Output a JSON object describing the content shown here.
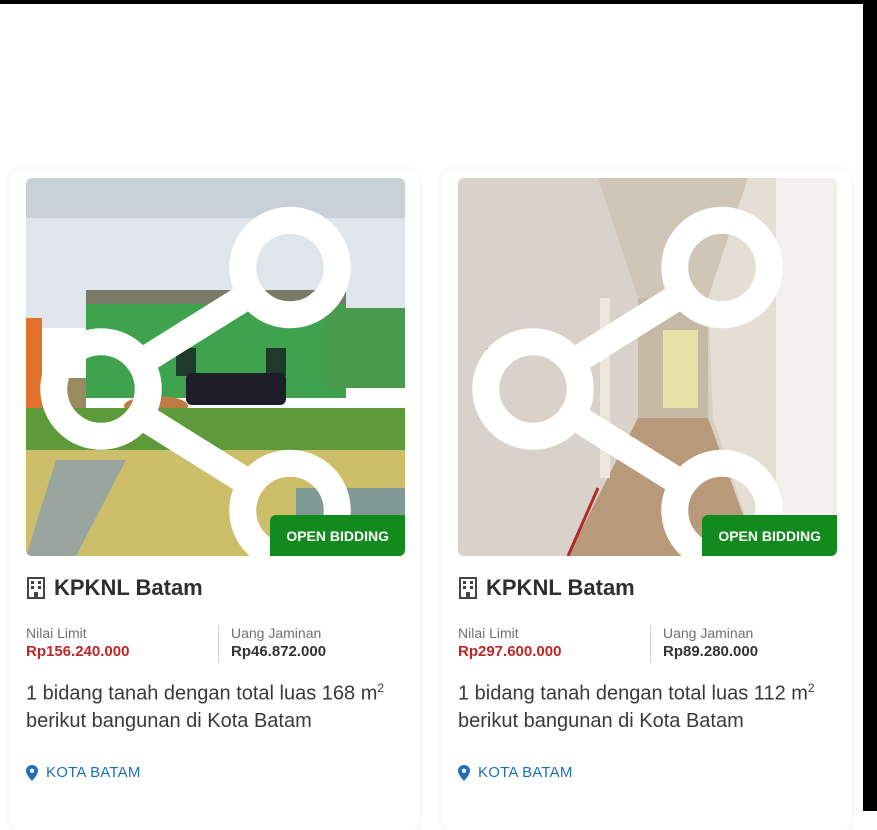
{
  "listings": [
    {
      "badge": "OPEN BIDDING",
      "office": "KPKNL Batam",
      "limit_label": "Nilai Limit",
      "limit_value": "Rp156.240.000",
      "deposit_label": "Uang Jaminan",
      "deposit_value": "Rp46.872.000",
      "desc_pre": "1 bidang tanah dengan total luas 168 m",
      "desc_sup": "2",
      "desc_post": " berikut bangunan di Kota Batam",
      "location": "KOTA BATAM"
    },
    {
      "badge": "OPEN BIDDING",
      "office": "KPKNL Batam",
      "limit_label": "Nilai Limit",
      "limit_value": "Rp297.600.000",
      "deposit_label": "Uang Jaminan",
      "deposit_value": "Rp89.280.000",
      "desc_pre": "1 bidang tanah dengan total luas 112 m",
      "desc_sup": "2",
      "desc_post": " berikut bangunan di Kota Batam",
      "location": "KOTA BATAM"
    }
  ],
  "colors": {
    "badge": "#128a1e",
    "limit": "#c02626",
    "location": "#1e6fb5"
  },
  "icons": [
    "share-icon",
    "building-icon",
    "map-pin-icon"
  ]
}
